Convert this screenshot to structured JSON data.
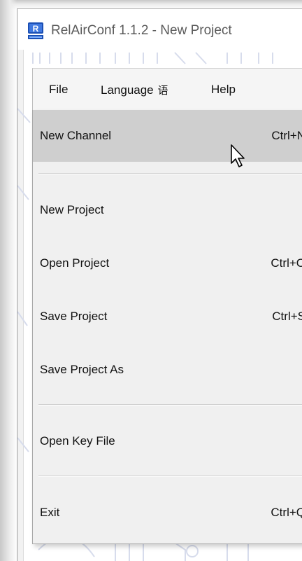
{
  "window": {
    "title": "RelAirConf 1.1.2 - New Project"
  },
  "menubar": {
    "file": "File",
    "language": "Language",
    "language_glyph": "语",
    "help": "Help"
  },
  "file_menu": {
    "items": [
      {
        "label": "New Channel",
        "shortcut": "Ctrl+N",
        "highlighted": true
      },
      {
        "label": "New Project",
        "shortcut": ""
      },
      {
        "label": "Open Project",
        "shortcut": "Ctrl+O"
      },
      {
        "label": "Save Project",
        "shortcut": "Ctrl+S"
      },
      {
        "label": "Save Project As",
        "shortcut": ""
      },
      {
        "label": "Open Key File",
        "shortcut": ""
      },
      {
        "label": "Exit",
        "shortcut": "Ctrl+Q"
      }
    ]
  },
  "icons": {
    "app": "relairconf-app-icon",
    "cursor": "mouse-pointer-icon"
  },
  "colors": {
    "menu_background": "#f0f0f0",
    "highlight": "#cfcfcf",
    "app_icon_blue": "#1b4fb4"
  }
}
